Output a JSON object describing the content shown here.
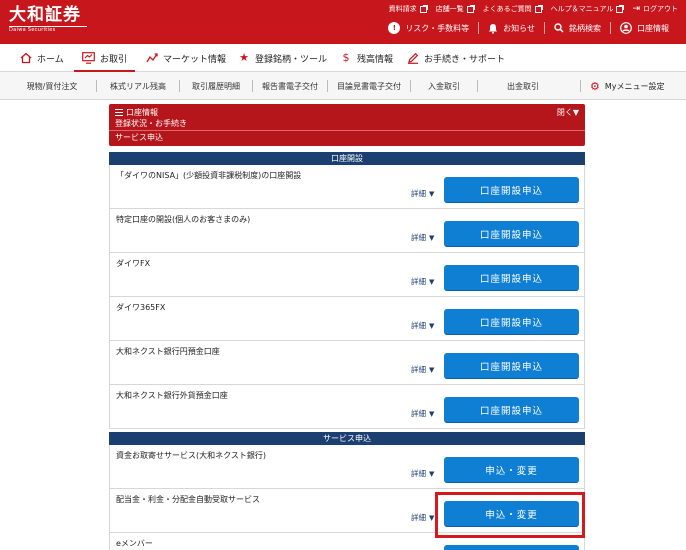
{
  "header": {
    "logo_text": "大和証券",
    "logo_sub": "Daiwa Securities",
    "links": [
      {
        "label": "資料請求"
      },
      {
        "label": "店舗一覧"
      },
      {
        "label": "よくあるご質問"
      },
      {
        "label": "ヘルプ＆マニュアル"
      },
      {
        "label": "ログアウト"
      }
    ],
    "sub": {
      "risk": "リスク・手数料等",
      "notice": "お知らせ",
      "search": "銘柄検索",
      "account": "口座情報"
    }
  },
  "main_nav": [
    {
      "label": "ホーム",
      "icon": "home-icon"
    },
    {
      "label": "お取引",
      "icon": "trade-icon"
    },
    {
      "label": "マーケット情報",
      "icon": "market-chart-icon"
    },
    {
      "label": "登録銘柄・ツール",
      "icon": "star-icon"
    },
    {
      "label": "残高情報",
      "icon": "dollar-icon"
    },
    {
      "label": "お手続き・サポート",
      "icon": "pen-icon"
    }
  ],
  "sub_nav": [
    {
      "label": "現物/買付注文"
    },
    {
      "label": "株式リアル残高"
    },
    {
      "label": "取引履歴明細"
    },
    {
      "label": "報告書電子交付"
    },
    {
      "label": "目論見書電子交付"
    },
    {
      "label": "入金取引"
    },
    {
      "label": "出金取引"
    }
  ],
  "my_menu": "Myメニュー設定",
  "panel": {
    "title": "口座情報",
    "line2": "登録状況・お手続き",
    "line3": "サービス申込",
    "close": "閉く▼"
  },
  "sections": [
    {
      "title": "口座開設",
      "rows": [
        {
          "label": "「ダイワのNISA」(少額投資非課税制度)の口座開設",
          "detail": "詳細",
          "button": "口座開設申込"
        },
        {
          "label": "特定口座の開設(個人のお客さまのみ)",
          "detail": "詳細",
          "button": "口座開設申込"
        },
        {
          "label": "ダイワFX",
          "detail": "詳細",
          "button": "口座開設申込"
        },
        {
          "label": "ダイワ365FX",
          "detail": "詳細",
          "button": "口座開設申込"
        },
        {
          "label": "大和ネクスト銀行円預金口座",
          "detail": "詳細",
          "button": "口座開設申込"
        },
        {
          "label": "大和ネクスト銀行外貨預金口座",
          "detail": "詳細",
          "button": "口座開設申込"
        }
      ]
    },
    {
      "title": "サービス申込",
      "rows": [
        {
          "label": "資金お取寄せサービス(大和ネクスト銀行)",
          "detail": "詳細",
          "button": "申込・変更"
        },
        {
          "label": "配当金・利金・分配金自動受取サービス",
          "detail": "詳細",
          "button": "申込・変更"
        },
        {
          "label": "eメンバー",
          "button": ""
        }
      ]
    }
  ],
  "colors": {
    "brand_red": "#c8161d",
    "navy": "#1c3f72",
    "button_blue": "#0f7fd3",
    "highlight": "#d41a1a"
  }
}
